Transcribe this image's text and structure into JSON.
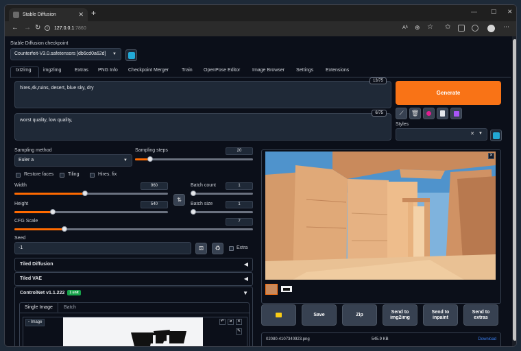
{
  "browser": {
    "tab_title": "Stable Diffusion",
    "url_host": "127.0.0.1",
    "url_port": ":7860"
  },
  "checkpoint": {
    "label": "Stable Diffusion checkpoint",
    "value": "Counterfeit-V3.0.safetensors [db6cd0a62d]"
  },
  "tabs": [
    "txt2img",
    "img2img",
    "Extras",
    "PNG Info",
    "Checkpoint Merger",
    "Train",
    "OpenPose Editor",
    "Image Browser",
    "Settings",
    "Extensions"
  ],
  "prompt": {
    "text": "hires,4k,ruins, desert, blue sky, dry",
    "counter": "13/75"
  },
  "negative": {
    "text": "worst quality, low quality,",
    "counter": "6/75"
  },
  "generate_label": "Generate",
  "styles_label": "Styles",
  "sampling": {
    "method_label": "Sampling method",
    "method_value": "Euler a",
    "steps_label": "Sampling steps",
    "steps_value": "20",
    "steps_fraction": 0.13
  },
  "checks": {
    "restore_faces": "Restore faces",
    "tiling": "Tiling",
    "hires_fix": "Hires. fix"
  },
  "width": {
    "label": "Width",
    "value": "960",
    "fraction": 0.46
  },
  "height": {
    "label": "Height",
    "value": "540",
    "fraction": 0.25
  },
  "batch_count": {
    "label": "Batch count",
    "value": "1",
    "fraction": 0.0
  },
  "batch_size": {
    "label": "Batch size",
    "value": "1",
    "fraction": 0.0
  },
  "cfg": {
    "label": "CFG Scale",
    "value": "7",
    "fraction": 0.21
  },
  "seed": {
    "label": "Seed",
    "value": "-1",
    "extra_label": "Extra"
  },
  "accordions": {
    "tiled_diffusion": "Tiled Diffusion",
    "tiled_vae": "Tiled VAE",
    "controlnet": "ControlNet v1.1.222",
    "controlnet_badge": "1 unit"
  },
  "controlnet_tabs": {
    "single": "Single Image",
    "batch": "Batch"
  },
  "image_label": "Image",
  "actions": {
    "folder": "folder",
    "save": "Save",
    "zip": "Zip",
    "send_img2img": "Send to img2img",
    "send_inpaint": "Send to inpaint",
    "send_extras": "Send to extras"
  },
  "file": {
    "name": "02080-4107340923.png",
    "size": "545.9 KB",
    "download": "Download"
  },
  "colors": {
    "accent": "#f97316",
    "slider": "#ff6a00",
    "bg": "#0b0f19",
    "panel": "#1f2937"
  }
}
